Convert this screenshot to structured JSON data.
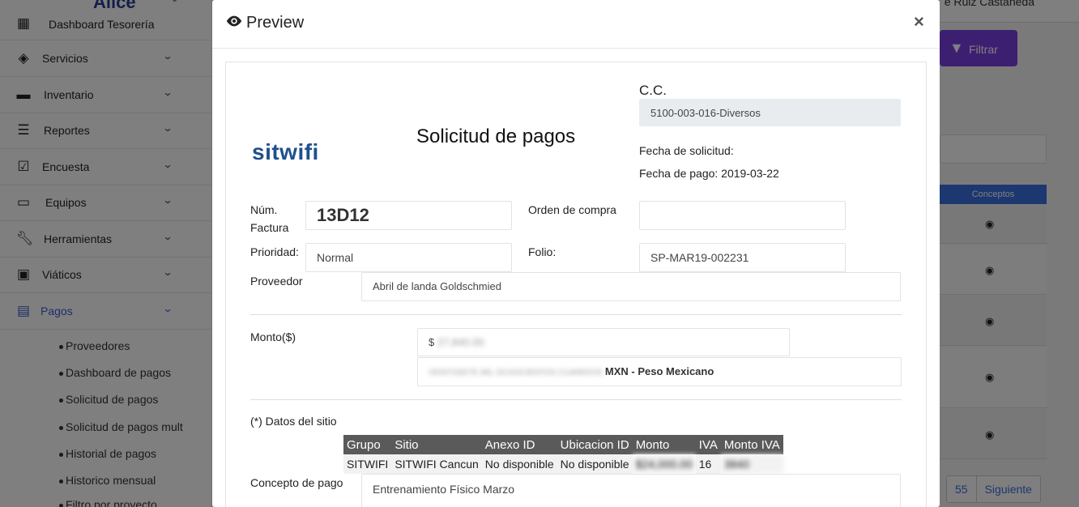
{
  "app": {
    "logo_text": "Alice",
    "logo_dash": "-",
    "user_name": "e Ruiz Castañeda"
  },
  "sidebar": {
    "items": [
      {
        "label": "Dashboard Tesorería",
        "icon": "cash-register-icon"
      },
      {
        "label": "Servicios",
        "icon": "layers-icon"
      },
      {
        "label": "Inventario",
        "icon": "archive-icon"
      },
      {
        "label": "Reportes",
        "icon": "server-icon"
      },
      {
        "label": "Encuesta",
        "icon": "calendar-check-icon"
      },
      {
        "label": "Equipos",
        "icon": "hdd-icon"
      },
      {
        "label": "Herramientas",
        "icon": "wrench-icon"
      },
      {
        "label": "Viáticos",
        "icon": "suitcase-icon"
      },
      {
        "label": "Pagos",
        "icon": "invoice-icon"
      }
    ],
    "sub_items": [
      "Proveedores",
      "Dashboard de pagos",
      "Solicitud de pagos",
      "Solicitud de pagos mult",
      "Historial de pagos",
      "Historico mensual",
      "Filtro por proyecto"
    ]
  },
  "background": {
    "filter_button": "Filtrar",
    "table_header": "Conceptos",
    "pager": [
      "55",
      "Siguiente"
    ]
  },
  "modal": {
    "title": "Preview",
    "close": "×",
    "logo": "sitwifi",
    "doc_title": "Solicitud de pagos",
    "cc_label": "C.C.",
    "cc_value": "5100-003-016-Diversos",
    "fecha_solicitud_label": "Fecha de solicitud:",
    "fecha_pago": "Fecha de pago: 2019-03-22",
    "num_factura_label_1": "Núm.",
    "num_factura_label_2": "Factura",
    "num_factura_value": "13D12",
    "orden_compra_label": "Orden de compra",
    "orden_compra_value": "",
    "prioridad_label": "Prioridad:",
    "prioridad_value": "Normal",
    "folio_label": "Folio:",
    "folio_value": "SP-MAR19-002231",
    "proveedor_label": "Proveedor",
    "proveedor_value": "Abril de landa Goldschmied",
    "monto_label": "Monto($)",
    "monto_prefix": "$",
    "monto_value": "27,840.00",
    "monto_letra": "VEINTISIETE MIL OCHOCIENTOS CUARENTA",
    "moneda": "MXN - Peso Mexicano",
    "datos_sitio_label": "(*) Datos del sitio",
    "table": {
      "headers": [
        "Grupo",
        "Sitio",
        "Anexo ID",
        "Ubicacion ID",
        "Monto",
        "IVA",
        "Monto IVA"
      ],
      "rows": [
        {
          "grupo": "SITWIFI",
          "sitio": "SITWIFI Cancun",
          "anexo": "No disponible",
          "ubicacion": "No disponible",
          "monto": "$24,000.00",
          "iva": "16",
          "monto_iva": "3840"
        }
      ]
    },
    "concepto_label": "Concepto de pago",
    "concepto_value": "Entrenamiento Físico Marzo"
  }
}
